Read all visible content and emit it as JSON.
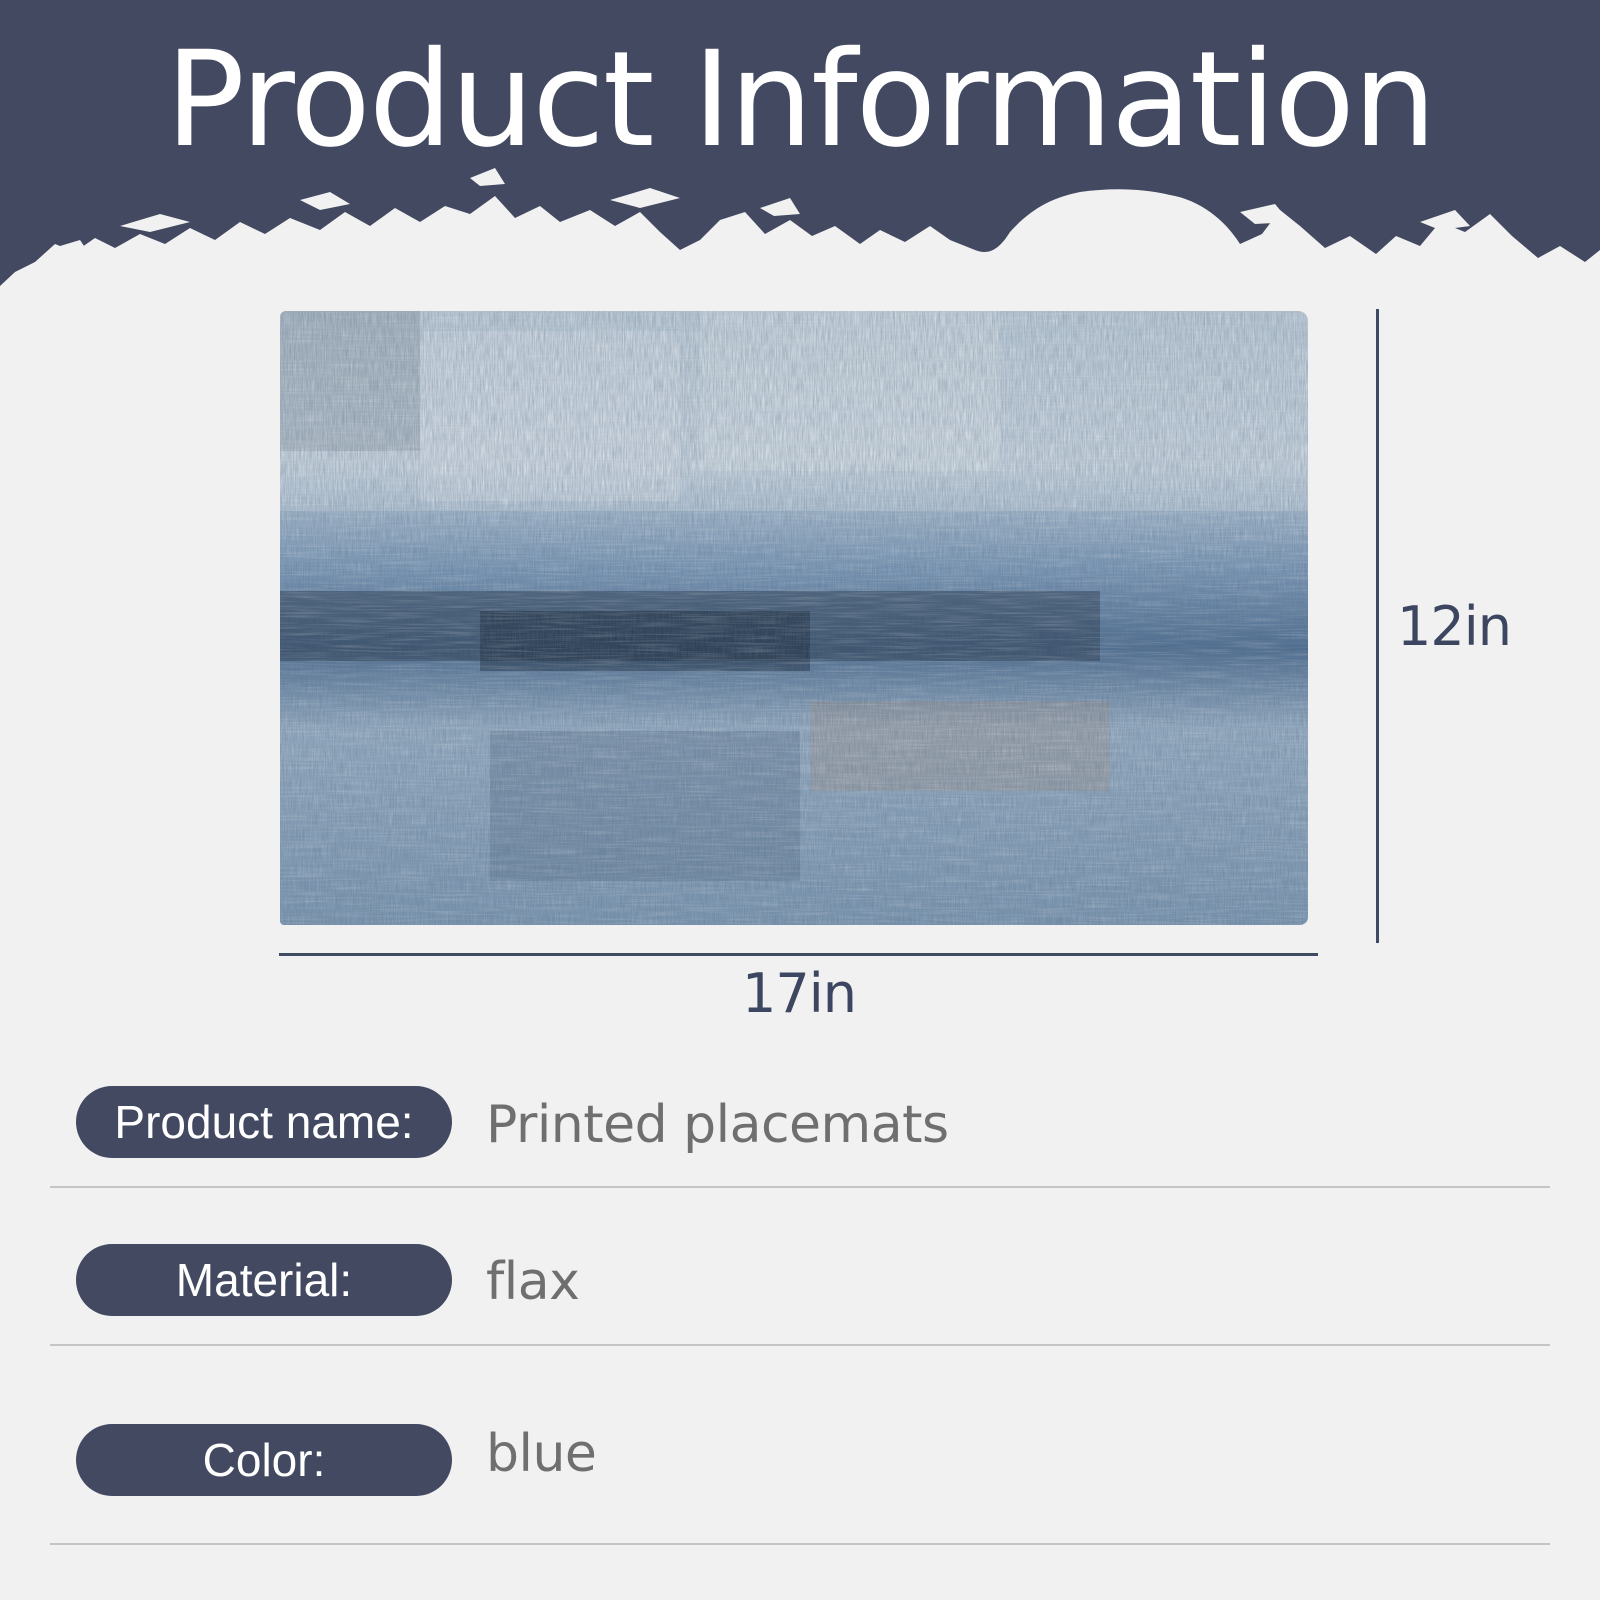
{
  "title": "Product Information",
  "colors": {
    "banner": "#424961",
    "background": "#f1f1f1",
    "pill": "#424961",
    "value_text": "#6f6f6f"
  },
  "product_image": "abstract blue-gray painted placemat",
  "dimensions": {
    "width_label": "17in",
    "height_label": "12in"
  },
  "rows": [
    {
      "label": "Product name:",
      "value": "Printed placemats"
    },
    {
      "label": "Material:",
      "value": "flax"
    },
    {
      "label": "Color:",
      "value": "blue"
    }
  ]
}
